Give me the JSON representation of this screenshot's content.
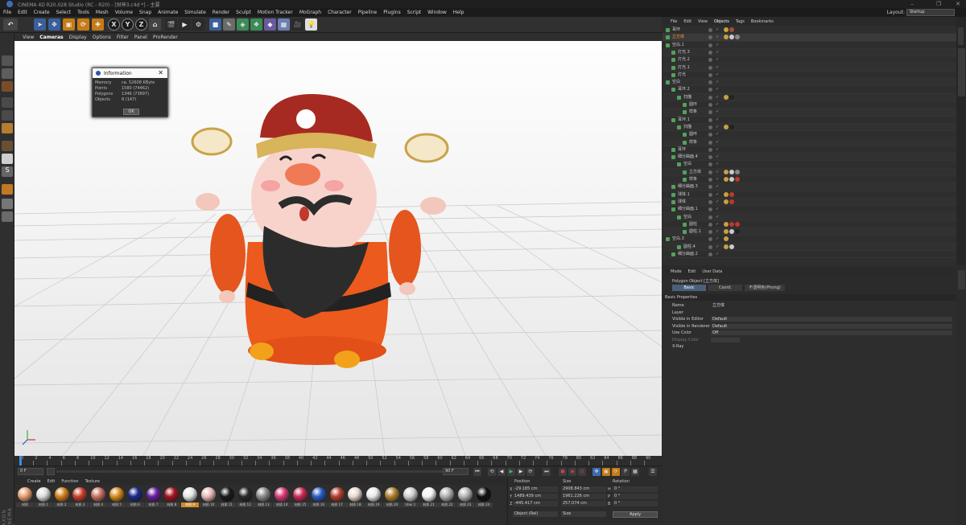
{
  "window": {
    "title": "CINEMA 4D R20.028 Studio (RC - R20) - [财神3.c4d *] - 主要"
  },
  "menubar": [
    "File",
    "Edit",
    "Create",
    "Select",
    "Tools",
    "Mesh",
    "Volume",
    "Snap",
    "Animate",
    "Simulate",
    "Render",
    "Sculpt",
    "Motion Tracker",
    "MoGraph",
    "Character",
    "Pipeline",
    "Plugins",
    "Script",
    "Window",
    "Help"
  ],
  "layout": {
    "label": "Layout:",
    "value": "Startup"
  },
  "toolbar": {
    "axes": [
      "X",
      "Y",
      "Z"
    ]
  },
  "viewport": {
    "menu": [
      "View",
      "Cameras",
      "Display",
      "Options",
      "Filter",
      "Panel",
      "ProRender"
    ],
    "active_menu": "Cameras"
  },
  "info_dialog": {
    "title": "Information",
    "rows": [
      {
        "k": "Memory",
        "v": "ca. 52608 KByte"
      },
      {
        "k": "Points",
        "v": "1580 (74462)"
      },
      {
        "k": "Polygons",
        "v": "1346 (73897)"
      },
      {
        "k": "Objects",
        "v": "8 (147)"
      }
    ],
    "ok": "OK"
  },
  "timeline": {
    "ticks": [
      "0",
      "2",
      "4",
      "6",
      "8",
      "10",
      "12",
      "14",
      "16",
      "18",
      "20",
      "22",
      "24",
      "26",
      "28",
      "30",
      "32",
      "34",
      "36",
      "38",
      "40",
      "42",
      "44",
      "46",
      "48",
      "50",
      "52",
      "54",
      "56",
      "58",
      "60",
      "62",
      "64",
      "66",
      "68",
      "70",
      "72",
      "74",
      "76",
      "78",
      "80",
      "82",
      "84",
      "86",
      "88",
      "90"
    ],
    "current": "0 F",
    "start": "0 F",
    "end": "90 F",
    "end2": "90 F"
  },
  "material_manager": {
    "menu": [
      "Create",
      "Edit",
      "Function",
      "Texture"
    ],
    "materials": [
      {
        "label": "材质",
        "color": "#e8a070"
      },
      {
        "label": "材质.1",
        "color": "#dcdcdc"
      },
      {
        "label": "材质.2",
        "color": "#d3801a"
      },
      {
        "label": "材质.3",
        "color": "#c9402a"
      },
      {
        "label": "材质.4",
        "color": "#c77061"
      },
      {
        "label": "材质.5",
        "color": "#d58b1a"
      },
      {
        "label": "材质.6",
        "color": "#1b2a8a"
      },
      {
        "label": "材质.7",
        "color": "#6a1f9c"
      },
      {
        "label": "材质.8",
        "color": "#a8121f"
      },
      {
        "label": "材质.9",
        "color": "#e6e6e6"
      },
      {
        "label": "材质.10",
        "color": "#e7b8b8"
      },
      {
        "label": "材质.11",
        "color": "#1a1a1a"
      },
      {
        "label": "材质.12",
        "color": "#2a2a2a"
      },
      {
        "label": "材质.13",
        "color": "#8a8a8a"
      },
      {
        "label": "材质.14",
        "color": "#d63a77"
      },
      {
        "label": "材质.15",
        "color": "#c82a58"
      },
      {
        "label": "材质.16",
        "color": "#2a5cc4"
      },
      {
        "label": "材质.17",
        "color": "#b53e2e"
      },
      {
        "label": "材质.18",
        "color": "#e8d8d0"
      },
      {
        "label": "材质.19",
        "color": "#e9e9e9"
      },
      {
        "label": "材质.20",
        "color": "#b08030"
      },
      {
        "label": "Uber.1",
        "color": "#cfcfcf"
      },
      {
        "label": "材质.21",
        "color": "#f5f5f5"
      },
      {
        "label": "材质.22",
        "color": "#b0b0b0"
      },
      {
        "label": "材质.23",
        "color": "#b5b5b5"
      },
      {
        "label": "材质.24",
        "color": "#111111"
      }
    ]
  },
  "coordinates": {
    "headers": [
      "Position",
      "Size",
      "Rotation"
    ],
    "rows": [
      {
        "axis": "X",
        "pos": "-29.185 cm",
        "size": "2908.843 cm",
        "rot_label": "H",
        "rot": "0 °"
      },
      {
        "axis": "Y",
        "pos": "1489.439 cm",
        "size": "1961.226 cm",
        "rot_label": "P",
        "rot": "0 °"
      },
      {
        "axis": "Z",
        "pos": "-445.417 cm",
        "size": "257.074 cm",
        "rot_label": "B",
        "rot": "0 °"
      }
    ],
    "mode": "Object (Rel)",
    "size_mode": "Size",
    "apply": "Apply"
  },
  "object_manager": {
    "menu": [
      "File",
      "Edit",
      "View",
      "Objects",
      "Tags",
      "Bookmarks"
    ],
    "rows": [
      {
        "name": "耳环",
        "indent": 0,
        "selected": false,
        "tags": [
          "#c8a040",
          "#a05030"
        ]
      },
      {
        "name": "立方体",
        "indent": 0,
        "selected": true,
        "tags": [
          "#c8a040",
          "#cccccc",
          "#888888"
        ]
      },
      {
        "name": "空白.1",
        "indent": 0,
        "selected": false,
        "tags": []
      },
      {
        "name": "灯光.3",
        "indent": 1,
        "selected": false,
        "tags": []
      },
      {
        "name": "灯光.2",
        "indent": 1,
        "selected": false,
        "tags": []
      },
      {
        "name": "灯光.1",
        "indent": 1,
        "selected": false,
        "tags": []
      },
      {
        "name": "灯光",
        "indent": 1,
        "selected": false,
        "tags": []
      },
      {
        "name": "空白",
        "indent": 0,
        "selected": false,
        "tags": []
      },
      {
        "name": "耳环.2",
        "indent": 1,
        "selected": false,
        "tags": []
      },
      {
        "name": "扫描",
        "indent": 2,
        "selected": false,
        "tags": [
          "#c8a040",
          "#222222"
        ]
      },
      {
        "name": "圆环",
        "indent": 3,
        "selected": false,
        "tags": []
      },
      {
        "name": "样条",
        "indent": 3,
        "selected": false,
        "tags": []
      },
      {
        "name": "耳环.1",
        "indent": 1,
        "selected": false,
        "tags": []
      },
      {
        "name": "扫描",
        "indent": 2,
        "selected": false,
        "tags": [
          "#c8a040",
          "#222222"
        ]
      },
      {
        "name": "圆环",
        "indent": 3,
        "selected": false,
        "tags": []
      },
      {
        "name": "样条",
        "indent": 3,
        "selected": false,
        "tags": []
      },
      {
        "name": "耳环",
        "indent": 1,
        "selected": false,
        "tags": []
      },
      {
        "name": "细分曲面.4",
        "indent": 1,
        "selected": false,
        "tags": []
      },
      {
        "name": "空白",
        "indent": 2,
        "selected": false,
        "tags": []
      },
      {
        "name": "立方体",
        "indent": 3,
        "selected": false,
        "tags": [
          "#c8a040",
          "#cccccc",
          "#888888"
        ]
      },
      {
        "name": "样条",
        "indent": 3,
        "selected": false,
        "tags": [
          "#c8a040",
          "#cccccc",
          "#c0392b"
        ]
      },
      {
        "name": "细分曲面.3",
        "indent": 1,
        "selected": false,
        "tags": []
      },
      {
        "name": "球体.1",
        "indent": 1,
        "selected": false,
        "tags": [
          "#c8a040",
          "#c0392b"
        ]
      },
      {
        "name": "球体",
        "indent": 1,
        "selected": false,
        "tags": [
          "#c8a040",
          "#c0392b"
        ]
      },
      {
        "name": "细分曲面.1",
        "indent": 1,
        "selected": false,
        "tags": []
      },
      {
        "name": "空白",
        "indent": 2,
        "selected": false,
        "tags": []
      },
      {
        "name": "圆柱",
        "indent": 3,
        "selected": false,
        "tags": [
          "#c8a040",
          "#c0392b",
          "#c0392b"
        ]
      },
      {
        "name": "圆柱.1",
        "indent": 3,
        "selected": false,
        "tags": [
          "#c8a040",
          "#cccccc",
          "#222222"
        ]
      },
      {
        "name": "空白.3",
        "indent": 0,
        "selected": false,
        "tags": [
          "#c8a040"
        ]
      },
      {
        "name": "圆柱.4",
        "indent": 2,
        "selected": false,
        "tags": [
          "#c8a040",
          "#cccccc"
        ]
      },
      {
        "name": "细分曲面.2",
        "indent": 1,
        "selected": false,
        "tags": []
      }
    ]
  },
  "attribute_manager": {
    "menu": [
      "Mode",
      "Edit",
      "User Data"
    ],
    "object_title": "Polygon Object [立方体]",
    "tabs": [
      "Basic",
      "Coord.",
      "不透明色(Phong)"
    ],
    "section": "Basic Properties",
    "fields": [
      {
        "label": "Name",
        "value": "立方体",
        "dim": false
      },
      {
        "label": "Layer",
        "value": "",
        "dim": false
      },
      {
        "label": "Visible in Editor",
        "value": "Default",
        "dim": false
      },
      {
        "label": "Visible in Renderer",
        "value": "Default",
        "dim": false
      },
      {
        "label": "Use Color",
        "value": "Off",
        "dim": false
      },
      {
        "label": "Display Color",
        "value": "",
        "dim": true
      },
      {
        "label": "X-Ray",
        "value": "",
        "dim": false
      }
    ]
  },
  "branding": {
    "maxon": "MAXON CINEMA 4D"
  }
}
